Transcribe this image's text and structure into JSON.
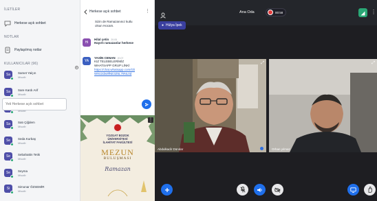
{
  "sidebar": {
    "section_messages": "İLETİLER",
    "public_chat": "Herkese açık sohbet",
    "section_notes": "NOTLAR",
    "shared_notes": "Paylaşılmış notlar",
    "section_users": "KULLANICILAR (96)",
    "users": [
      {
        "initials": "Sa",
        "name": "Samet Yalçın",
        "role": "Misafir"
      },
      {
        "initials": "Sa",
        "name": "Sare Kardı Arif",
        "role": "Misafir"
      },
      {
        "initials": "Sa",
        "name": "Sare Sema Şakirk",
        "role": "Misafir"
      },
      {
        "initials": "Sa",
        "name": "Satı Çiğdem",
        "role": "Misafir"
      },
      {
        "initials": "Se",
        "name": "Seda Kurbaş",
        "role": "Misafir"
      },
      {
        "initials": "Se",
        "name": "Sebahattin Tetik",
        "role": "Misafir"
      },
      {
        "initials": "Se",
        "name": "Seyma",
        "role": "Misafir"
      },
      {
        "initials": "Si",
        "name": "Simonar ÖZSEMİR",
        "role": "Misafir"
      }
    ]
  },
  "chat": {
    "header": "Herkese açık sohbet",
    "messages": [
      {
        "lines": [
          "Sizin de Ramazanınız kutlu",
          "olsun Hocam."
        ]
      },
      {
        "initials": "Hi",
        "name": "Hilal çetin",
        "time": "20:05",
        "text": "Hayırlı ramazanlar herkese"
      },
      {
        "initials": "YA",
        "name": "YASİN CENAN",
        "time": "20:07",
        "lines": [
          "KIZ TELEBELERİMİZ",
          "WHATSAPP GRUP LİNKİ"
        ],
        "link_lines": [
          "https://chat.whatsapp.com/Gli",
          "W9U2dw9fNE3Z5L79NL0d"
        ]
      }
    ],
    "input_placeholder": "Yeti Herkese açık sohbet"
  },
  "poster": {
    "lines": [
      "YOZGAT BOZOK",
      "ÜNİVERSİTESİ",
      "İLAHİYAT FAKÜLTESİ"
    ],
    "big1": "MEZUN",
    "big2": "BULUŞMASI",
    "script": "Ramazan"
  },
  "video": {
    "room": "Ana Oda",
    "rec": "00:58",
    "presenter": "Hülya İpek",
    "tiles": [
      {
        "name": "Abdulkadir Dündar"
      },
      {
        "name": "Orhan yılmaz"
      }
    ]
  }
}
